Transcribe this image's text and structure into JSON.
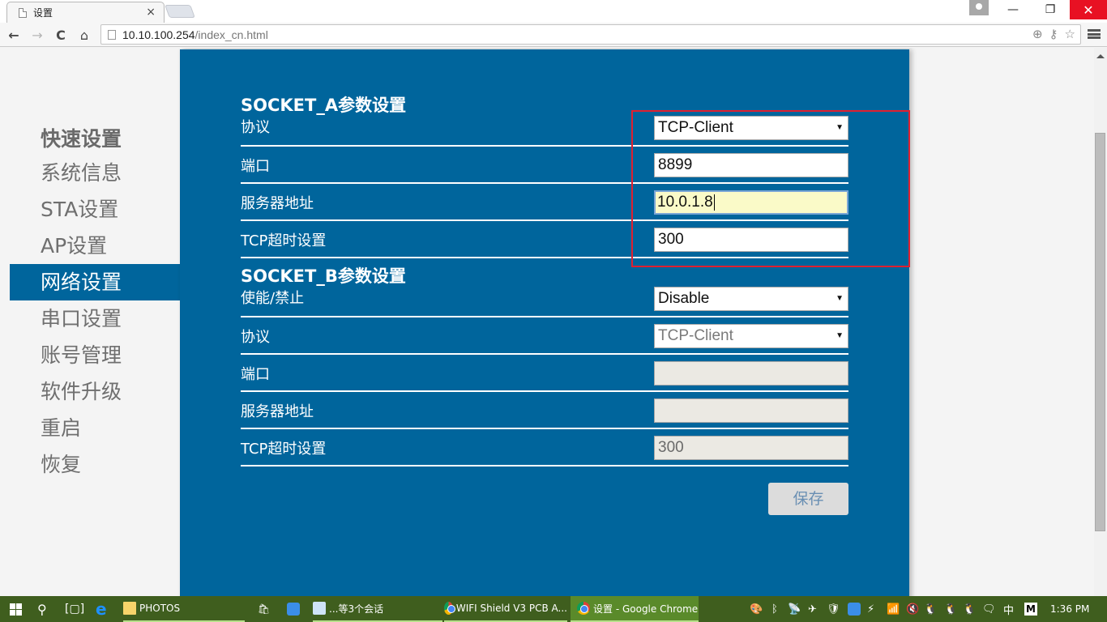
{
  "browser": {
    "tab_title": "设置",
    "tab_close": "×",
    "url_host": "10.10.100.254",
    "url_path": "/index_cn.html",
    "window_controls": {
      "minimize": "—",
      "restore": "❐",
      "close": "✕"
    },
    "nav": {
      "back": "←",
      "forward": "→",
      "reload": "C",
      "home": "⌂"
    },
    "omni_icons": {
      "zoom": "⊕",
      "key": "⚷",
      "bookmark": "☆"
    }
  },
  "sidebar": {
    "items": [
      {
        "label": "快速设置",
        "type": "header"
      },
      {
        "label": "系统信息"
      },
      {
        "label": "STA设置"
      },
      {
        "label": "AP设置"
      },
      {
        "label": "网络设置",
        "active": true
      },
      {
        "label": "串口设置"
      },
      {
        "label": "账号管理"
      },
      {
        "label": "软件升级"
      },
      {
        "label": "重启"
      },
      {
        "label": "恢复"
      }
    ]
  },
  "socket_a": {
    "title": "SOCKET_A参数设置",
    "protocol": {
      "label": "协议",
      "value": "TCP-Client"
    },
    "port": {
      "label": "端口",
      "value": "8899"
    },
    "server": {
      "label": "服务器地址",
      "value": "10.0.1.8"
    },
    "timeout": {
      "label": "TCP超时设置",
      "value": "300"
    }
  },
  "socket_b": {
    "title": "SOCKET_B参数设置",
    "enable": {
      "label": "使能/禁止",
      "value": "Disable"
    },
    "protocol": {
      "label": "协议",
      "value": "TCP-Client"
    },
    "port": {
      "label": "端口",
      "value": ""
    },
    "server": {
      "label": "服务器地址",
      "value": ""
    },
    "timeout": {
      "label": "TCP超时设置",
      "value": "300"
    }
  },
  "save_label": "保存",
  "select_arrow": "▼",
  "colors": {
    "panel": "#00659c",
    "highlight_box": "#e02030",
    "focused_input": "#fafac8",
    "taskbar": "#3f5e1e"
  },
  "taskbar": {
    "items": [
      {
        "label": "PHOTOS"
      },
      {
        "label": "...等3个会话"
      },
      {
        "label": "WIFI Shield V3 PCB A..."
      },
      {
        "label": "设置 - Google Chrome",
        "active": true
      }
    ],
    "ime": "中",
    "ime_mode": "M",
    "clock": "1:36 PM"
  }
}
